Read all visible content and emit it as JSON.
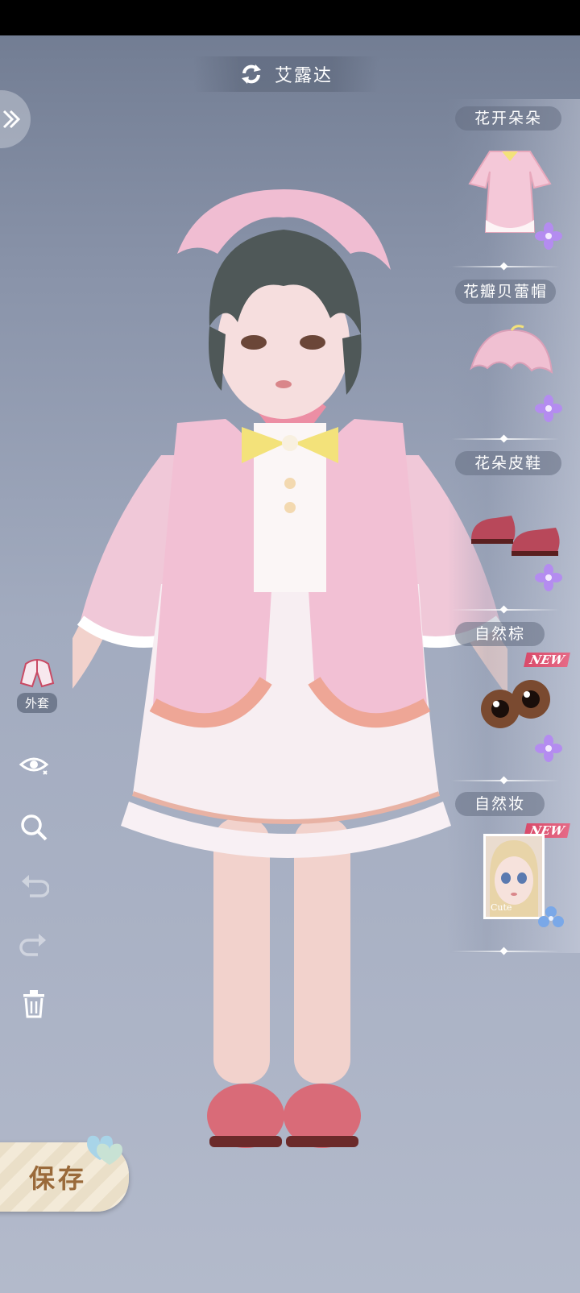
{
  "character_name": "艾露达",
  "left_tools": {
    "outerwear_label": "外套"
  },
  "items": [
    {
      "name": "花开朵朵",
      "icon": "dress-thumbnail",
      "rarity": "purple-flower"
    },
    {
      "name": "花瓣贝蕾帽",
      "icon": "petal-hat-thumbnail",
      "rarity": "purple-flower"
    },
    {
      "name": "花朵皮鞋",
      "icon": "shoes-thumbnail",
      "rarity": "purple-flower"
    },
    {
      "name": "自然棕",
      "icon": "brown-eyes-thumbnail",
      "rarity": "purple-flower",
      "badge": "NEW"
    },
    {
      "name": "自然妆",
      "icon": "makeup-thumbnail",
      "rarity": "blue-flower",
      "badge": "NEW",
      "thumb_caption": "Cute"
    }
  ],
  "save_label": "保存",
  "colors": {
    "accent_pink": "#f0b8c8",
    "badge_red": "#d94a6a",
    "save_text": "#9a6a3a",
    "purple_flower": "#b48cf0",
    "blue_flower": "#7aa8e8"
  }
}
